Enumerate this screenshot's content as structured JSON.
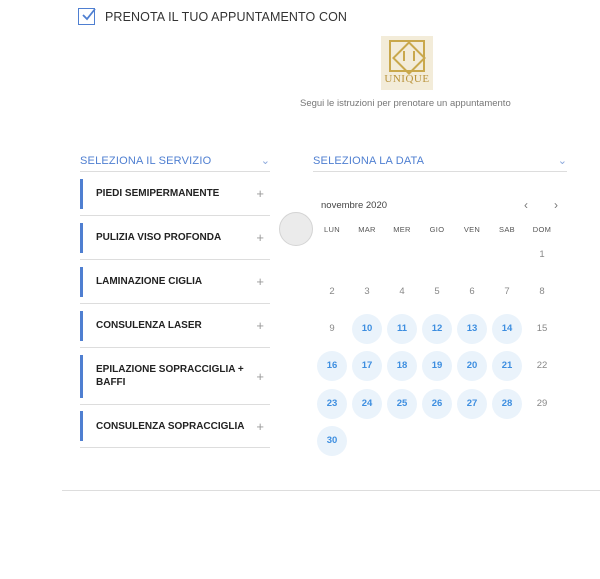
{
  "header": {
    "title": "PRENOTA IL TUO APPUNTAMENTO CON",
    "checked": true
  },
  "logo": {
    "text": "UNIQUE",
    "color": "#c9a84c"
  },
  "subtitle": "Segui le istruzioni per prenotare un appuntamento",
  "services": {
    "header": "SELEZIONA IL SERVIZIO",
    "items": [
      {
        "label": "PIEDI SEMIPERMANENTE",
        "icon": "plus-icon"
      },
      {
        "label": "PULIZIA VISO PROFONDA",
        "icon": "plus-icon"
      },
      {
        "label": "LAMINAZIONE CIGLIA",
        "icon": "plus-icon"
      },
      {
        "label": "CONSULENZA LASER",
        "icon": "plus-icon"
      },
      {
        "label": "EPILAZIONE SOPRACCIGLIA + BAFFI",
        "icon": "plus-icon"
      },
      {
        "label": "CONSULENZA SOPRACCIGLIA",
        "icon": "plus-icon"
      }
    ]
  },
  "calendar": {
    "header": "SELEZIONA LA DATA",
    "month": "novembre 2020",
    "prev_icon": "chevron-left-icon",
    "next_icon": "chevron-right-icon",
    "weekdays": [
      "LUN",
      "MAR",
      "MER",
      "GIO",
      "VEN",
      "SAB",
      "DOM"
    ],
    "days": [
      {
        "day": "1",
        "available": false
      },
      {
        "day": "2",
        "available": false
      },
      {
        "day": "3",
        "available": false
      },
      {
        "day": "4",
        "available": false
      },
      {
        "day": "5",
        "available": false
      },
      {
        "day": "6",
        "available": false
      },
      {
        "day": "7",
        "available": false
      },
      {
        "day": "8",
        "available": false
      },
      {
        "day": "9",
        "available": false
      },
      {
        "day": "10",
        "available": true
      },
      {
        "day": "11",
        "available": true
      },
      {
        "day": "12",
        "available": true
      },
      {
        "day": "13",
        "available": true
      },
      {
        "day": "14",
        "available": true
      },
      {
        "day": "15",
        "available": false
      },
      {
        "day": "16",
        "available": true
      },
      {
        "day": "17",
        "available": true
      },
      {
        "day": "18",
        "available": true
      },
      {
        "day": "19",
        "available": true
      },
      {
        "day": "20",
        "available": true
      },
      {
        "day": "21",
        "available": true
      },
      {
        "day": "22",
        "available": false
      },
      {
        "day": "23",
        "available": true
      },
      {
        "day": "24",
        "available": true
      },
      {
        "day": "25",
        "available": true
      },
      {
        "day": "26",
        "available": true
      },
      {
        "day": "27",
        "available": true
      },
      {
        "day": "28",
        "available": true
      },
      {
        "day": "29",
        "available": false
      },
      {
        "day": "30",
        "available": true
      }
    ]
  },
  "colors": {
    "accent": "#4f7fd1",
    "available_day_bg": "#eaf3fb",
    "available_day_text": "#3d8ee0"
  }
}
